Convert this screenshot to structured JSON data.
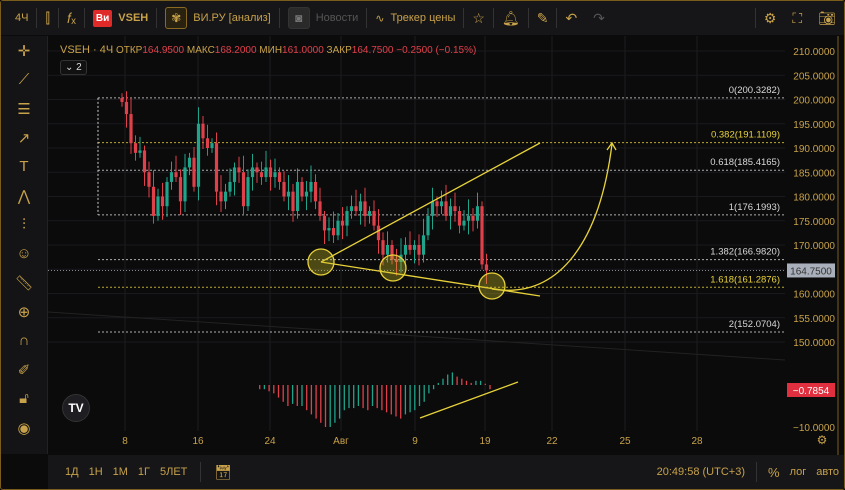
{
  "topbar": {
    "interval": "4Ч",
    "symbol": "VSEH",
    "analysis": "ВИ.РУ [анализ]",
    "news": "Новости",
    "tracker": "Трекер цены",
    "badge": "Ви"
  },
  "legend": {
    "title": "VSEH · 4Ч",
    "open_label": "ОТКР",
    "open": "164.9500",
    "high_label": "МАКС",
    "high": "168.2000",
    "low_label": "МИН",
    "low": "161.0000",
    "close_label": "ЗАКР",
    "close": "164.7500",
    "change": "−0.2500 (−0.15%)",
    "indicators_toggle": "2"
  },
  "price_axis": [
    "210.0000",
    "205.0000",
    "200.0000",
    "195.0000",
    "190.0000",
    "185.0000",
    "180.0000",
    "175.0000",
    "170.0000",
    "165.0000",
    "160.0000",
    "155.0000",
    "150.0000"
  ],
  "last_price": "164.7500",
  "fib_levels": [
    {
      "label": "0(200.3282)",
      "price": 200.3282,
      "color": "#d8d8d8"
    },
    {
      "label": "0.382(191.1109)",
      "price": 191.1109,
      "color": "#e8d23a"
    },
    {
      "label": "0.618(185.4165)",
      "price": 185.4165,
      "color": "#d8d8d8"
    },
    {
      "label": "1(176.1993)",
      "price": 176.1993,
      "color": "#d8d8d8"
    },
    {
      "label": "1.382(166.9820)",
      "price": 166.982,
      "color": "#d8d8d8"
    },
    {
      "label": "1.618(161.2876)",
      "price": 161.2876,
      "color": "#e8d23a"
    },
    {
      "label": "2(152.0704)",
      "price": 152.0704,
      "color": "#d8d8d8"
    }
  ],
  "oscillator": {
    "value": "−0.7854",
    "axis_label": "−10.0000",
    "histogram": [
      0.0,
      -1,
      -1,
      -1.5,
      -2,
      -3,
      -4,
      -5,
      -4.5,
      -5,
      -5,
      -6,
      -7,
      -8,
      -9,
      -10,
      -10,
      -9,
      -8,
      -6,
      -5.5,
      -5.5,
      -5,
      -5.5,
      -6,
      -5,
      -5.5,
      -6,
      -6.5,
      -7,
      -7.5,
      -8,
      -7,
      -6.5,
      -6,
      -5,
      -4,
      -2,
      -1,
      0.5,
      1.5,
      2.5,
      3,
      2,
      1.5,
      1,
      0.5,
      1,
      1,
      0.3,
      -1
    ],
    "colors": {
      "up": "#1fa38a",
      "down": "#e0404a"
    }
  },
  "time_axis": [
    "8",
    "16",
    "24",
    "Авг",
    "9",
    "19",
    "22",
    "25",
    "28"
  ],
  "closes": [
    199.5,
    197,
    191,
    189,
    189.5,
    185,
    182,
    176,
    180,
    178,
    183,
    185,
    184,
    179,
    186,
    188,
    182,
    195,
    192,
    190,
    191,
    181,
    179,
    181,
    183,
    186,
    185,
    178,
    184,
    186,
    185,
    184,
    186,
    184,
    185,
    183,
    180,
    181,
    177,
    183,
    180,
    181,
    183,
    179,
    176,
    173,
    173.5,
    172,
    175,
    174,
    177,
    178,
    177,
    179,
    176,
    177,
    174,
    171,
    168,
    170,
    167,
    166.5,
    168,
    170,
    169,
    170,
    168,
    172,
    176,
    179,
    178,
    179,
    176,
    178,
    177,
    174,
    175,
    176,
    175,
    178,
    166,
    164.75
  ],
  "bottom": {
    "ranges": [
      "1Д",
      "1Н",
      "1М",
      "1Г",
      "5ЛЕТ"
    ],
    "clock": "20:49:58 (UTC+3)",
    "percent": "%",
    "log": "лог",
    "auto": "авто"
  },
  "colors": {
    "accent": "#c8a24a",
    "up": "#1fa38a",
    "down": "#e0404a",
    "drawing": "#e8d23a"
  }
}
